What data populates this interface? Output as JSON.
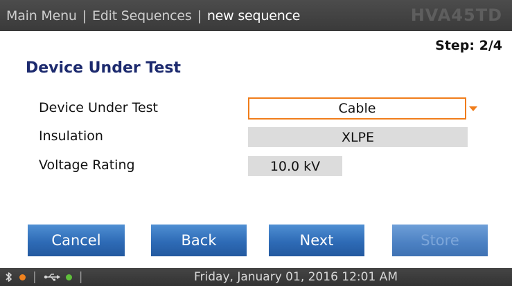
{
  "header": {
    "breadcrumb": [
      {
        "label": "Main Menu"
      },
      {
        "label": "Edit Sequences"
      },
      {
        "label": "new sequence"
      }
    ],
    "separator": "|",
    "brand": "HVA45TD"
  },
  "step": {
    "label": "Step: 2/4"
  },
  "section": {
    "title": "Device Under Test"
  },
  "fields": {
    "device_under_test": {
      "label": "Device Under Test",
      "value": "Cable"
    },
    "insulation": {
      "label": "Insulation",
      "value": "XLPE"
    },
    "voltage_rating": {
      "label": "Voltage Rating",
      "value": "10.0 kV"
    }
  },
  "buttons": {
    "cancel": "Cancel",
    "back": "Back",
    "next": "Next",
    "store": "Store"
  },
  "statusbar": {
    "separator": "|",
    "datetime": "Friday, January 01, 2016 12:01 AM",
    "icons": [
      "bluetooth-icon",
      "usb-icon"
    ],
    "indicator_colors": {
      "bluetooth": "#f0821e",
      "usb": "#5fbf3b"
    }
  },
  "colors": {
    "accent": "#f07c1a",
    "title": "#1c2a6e",
    "button": "#2e6bb6"
  }
}
